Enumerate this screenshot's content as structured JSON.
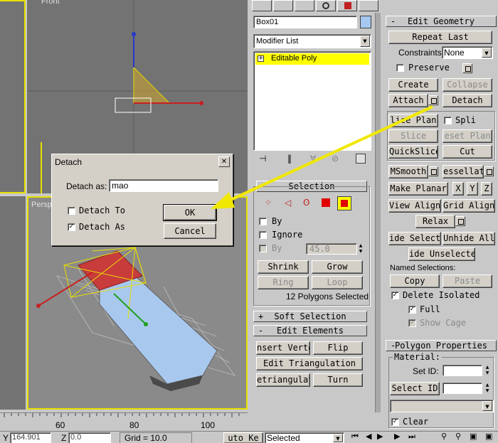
{
  "viewports": {
    "front_label": "Front",
    "perspective_label": "Persp"
  },
  "dialog": {
    "title": "Detach",
    "detach_as_label": "Detach as:",
    "detach_as_value": "mao",
    "detach_to_label": "Detach To",
    "detach_as_clone_label": "Detach As",
    "ok_label": "OK",
    "cancel_label": "Cancel"
  },
  "modifier_panel": {
    "object_name": "Box01",
    "object_color": "#a6c8f0",
    "modifier_list_label": "Modifier List",
    "stack_items": [
      "Editable Poly"
    ]
  },
  "selection": {
    "header": "Selection",
    "by_label": "By",
    "ignore_label": "Ignore",
    "by_angle_label": "By",
    "angle_value": "45.0",
    "shrink_label": "Shrink",
    "grow_label": "Grow",
    "ring_label": "Ring",
    "loop_label": "Loop",
    "status": "12 Polygons Selected"
  },
  "soft_selection": {
    "header": "Soft Selection"
  },
  "edit_elements": {
    "header": "Edit Elements",
    "insert_vertex_label": "nsert Verte",
    "flip_label": "Flip",
    "edit_triangulation_label": "Edit Triangulation",
    "retriangulate_label": "etriangulat",
    "turn_label": "Turn"
  },
  "edit_geometry": {
    "header": "Edit Geometry",
    "repeat_last_label": "Repeat Last",
    "constraints_label": "Constraints:",
    "constraints_value": "None",
    "preserve_label": "Preserve",
    "create_label": "Create",
    "collapse_label": "Collapse",
    "attach_label": "Attach",
    "detach_label": "Detach",
    "slice_plane_label": "lice Plan",
    "split_label": "Spli",
    "slice_label": "Slice",
    "reset_plane_label": "eset Plan",
    "quickslice_label": "QuickSlice",
    "cut_label": "Cut",
    "msmooth_label": "MSmooth",
    "tessellate_label": "essellat",
    "make_planar_label": "Make Planar",
    "x_label": "X",
    "y_label": "Y",
    "z_label": "Z",
    "view_align_label": "View Align",
    "grid_align_label": "Grid Align",
    "relax_label": "Relax",
    "hide_selected_label": "ide Selecte",
    "unhide_all_label": "Unhide All",
    "hide_unselected_label": "ide Unselecte",
    "named_selections_label": "Named Selections:",
    "copy_label": "Copy",
    "paste_label": "Paste",
    "delete_isolated_label": "Delete Isolated",
    "full_label": "Full",
    "show_cage_label": "Show Cage"
  },
  "polygon_properties": {
    "header": "Polygon Properties",
    "material_label": "Material:",
    "set_id_label": "Set ID:",
    "select_id_label": "Select ID",
    "clear_label": "Clear"
  },
  "ruler": {
    "ticks": [
      "60",
      "80",
      "100"
    ]
  },
  "statusbar": {
    "y_label": "Y",
    "y_value": "164.901",
    "z_label": "Z",
    "z_value": "0.0",
    "grid_label": "Grid = 10.0",
    "auto_key_label": "uto Ke",
    "selection_dropdown": "Selected"
  },
  "colors": {
    "viewport_bg": "#8a8a8a",
    "viewport_front_bg": "#737373",
    "active_border": "#e8e000",
    "arrow": "#f0e800",
    "stack_highlight": "#ffff00",
    "box_top": "#c83c3c",
    "box_side": "#a8c8ee"
  }
}
